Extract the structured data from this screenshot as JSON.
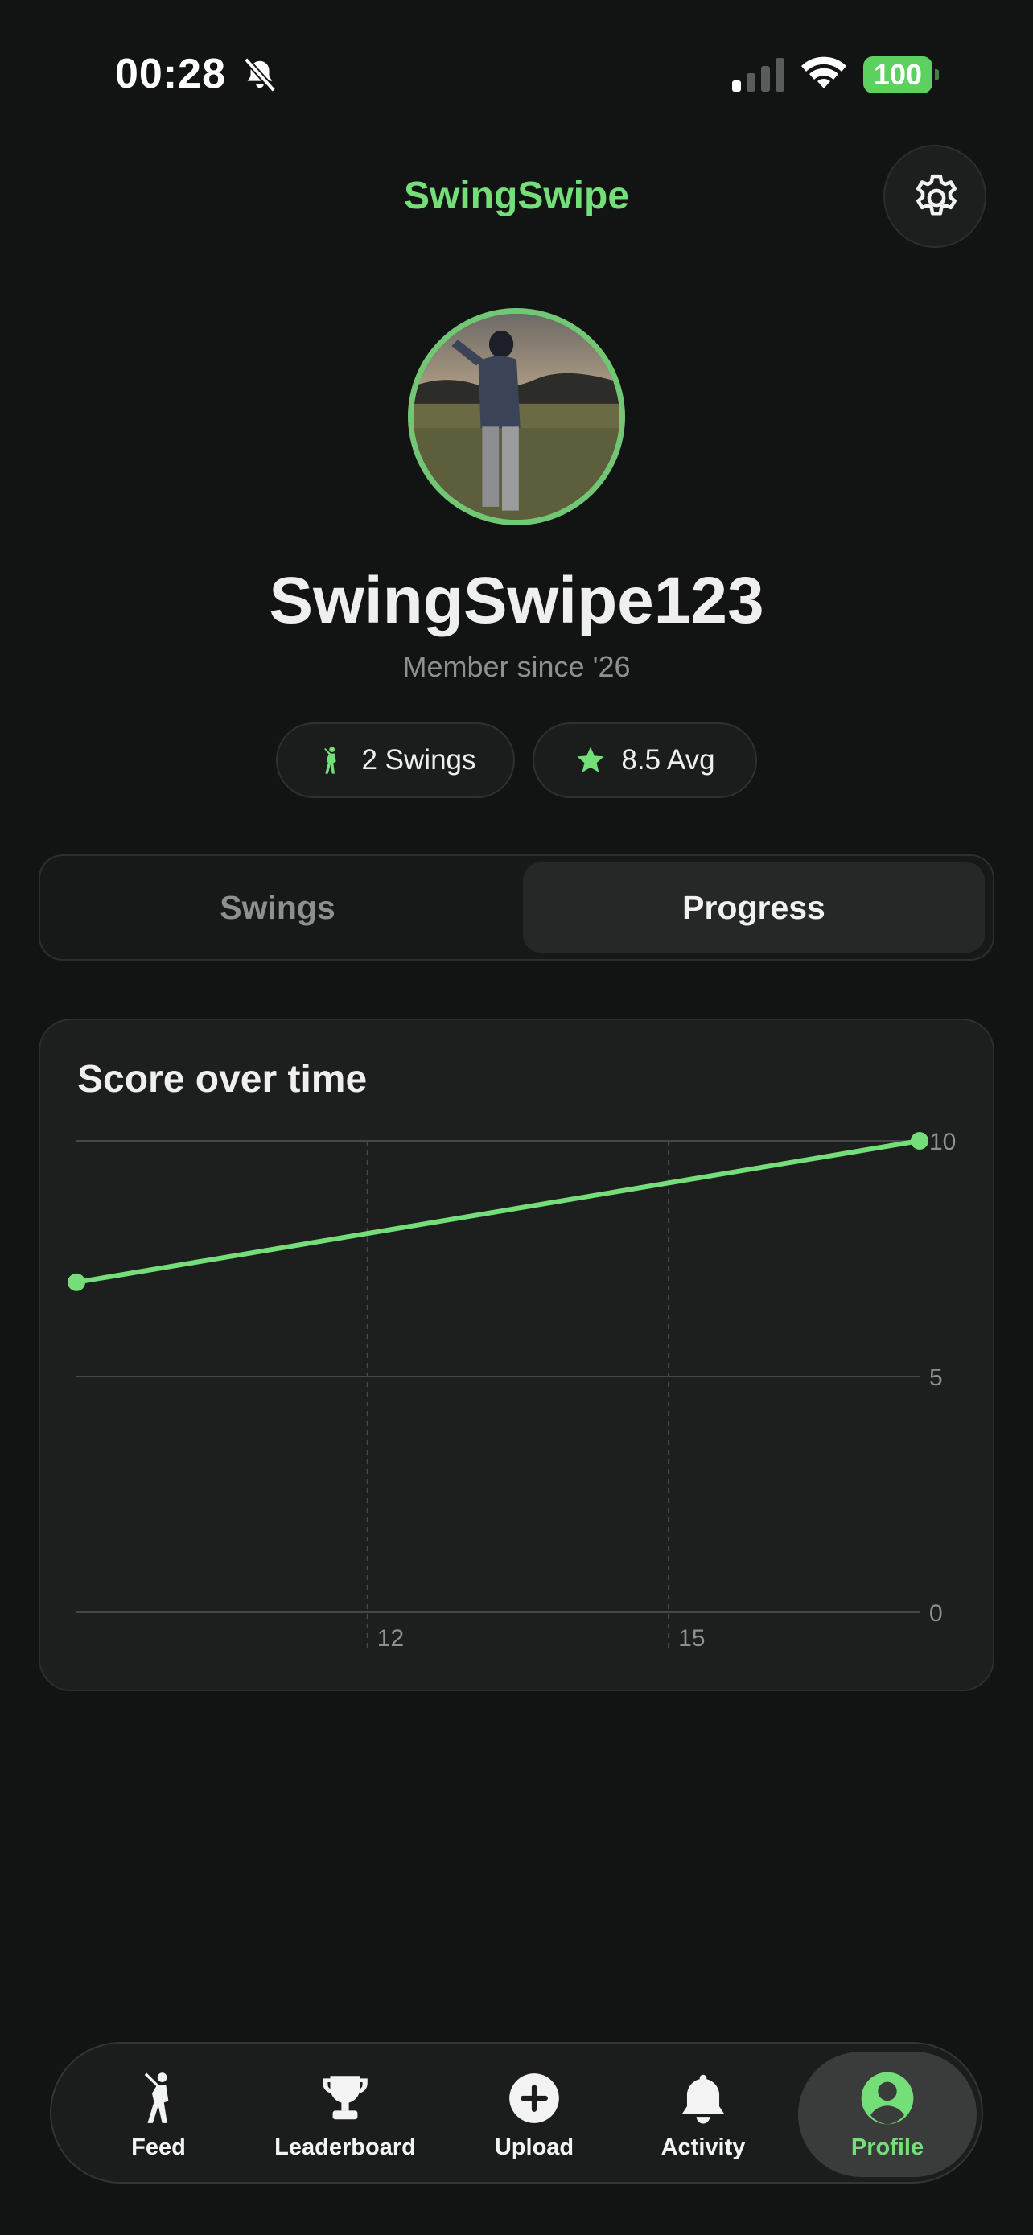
{
  "status_bar": {
    "time": "00:28",
    "battery": "100",
    "icons": [
      "bell-off-icon",
      "signal-icon",
      "wifi-icon",
      "battery-icon"
    ]
  },
  "header": {
    "title": "SwingSwipe",
    "settings_icon": "gear-icon"
  },
  "profile": {
    "username": "SwingSwipe123",
    "member_since": "Member since '26",
    "stats": {
      "swings": "2 Swings",
      "avg": "8.5 Avg"
    }
  },
  "tabs": {
    "swings": "Swings",
    "progress": "Progress",
    "selected": "Progress"
  },
  "chart": {
    "title": "Score over time"
  },
  "chart_data": {
    "type": "line",
    "title": "Score over time",
    "x_ticks": [
      "12",
      "15"
    ],
    "y_ticks": [
      "0",
      "5",
      "10"
    ],
    "ylim": [
      0,
      10
    ],
    "xlim": [
      9.1,
      17.5
    ],
    "x": [
      9.1,
      17.5
    ],
    "values": [
      7,
      10
    ],
    "color": "#74df78",
    "grid": true,
    "y_axis_position": "right"
  },
  "tabbar": {
    "items": [
      {
        "label": "Feed",
        "icon": "golfer-icon"
      },
      {
        "label": "Leaderboard",
        "icon": "trophy-icon"
      },
      {
        "label": "Upload",
        "icon": "plus-circle-icon"
      },
      {
        "label": "Activity",
        "icon": "bell-icon"
      },
      {
        "label": "Profile",
        "icon": "person-circle-icon"
      }
    ],
    "active": "Profile"
  },
  "colors": {
    "accent": "#74df78",
    "background": "#121313",
    "card": "#1d1e1e"
  }
}
